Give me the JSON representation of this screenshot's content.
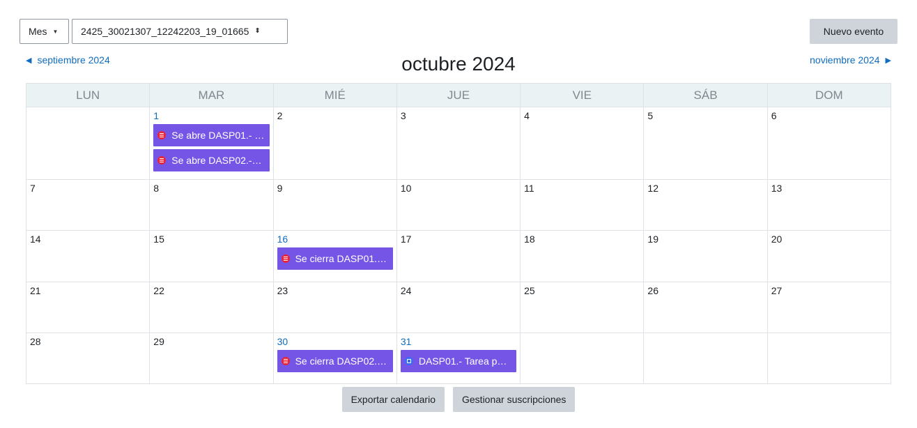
{
  "toolbar": {
    "view_select": "Mes",
    "course_select": "2425_30021307_12242203_19_01665",
    "new_event": "Nuevo evento"
  },
  "navigation": {
    "prev_month": "septiembre 2024",
    "current_month": "octubre 2024",
    "next_month": "noviembre 2024"
  },
  "weekdays": [
    "LUN",
    "MAR",
    "MIÉ",
    "JUE",
    "VIE",
    "SÁB",
    "DOM"
  ],
  "days": {
    "d1": "1",
    "d2": "2",
    "d3": "3",
    "d4": "4",
    "d5": "5",
    "d6": "6",
    "d7": "7",
    "d8": "8",
    "d9": "9",
    "d10": "10",
    "d11": "11",
    "d12": "12",
    "d13": "13",
    "d14": "14",
    "d15": "15",
    "d16": "16",
    "d17": "17",
    "d18": "18",
    "d19": "19",
    "d20": "20",
    "d21": "21",
    "d22": "22",
    "d23": "23",
    "d24": "24",
    "d25": "25",
    "d26": "26",
    "d27": "27",
    "d28": "28",
    "d29": "29",
    "d30": "30",
    "d31": "31"
  },
  "events": {
    "oct1_a": "Se abre DASP01.- …",
    "oct1_b": "Se abre DASP02.-…",
    "oct16": "Se cierra DASP01.…",
    "oct30": "Se cierra DASP02.…",
    "oct31": "DASP01.- Tarea p…"
  },
  "footer": {
    "export": "Exportar calendario",
    "subscriptions": "Gestionar suscripciones"
  },
  "colors": {
    "event_bg": "#7555e5",
    "link": "#0f6cbf",
    "header_bg": "#eaf2f3",
    "quiz_icon": "#e8253b",
    "assign_icon": "#3b6cf0"
  }
}
